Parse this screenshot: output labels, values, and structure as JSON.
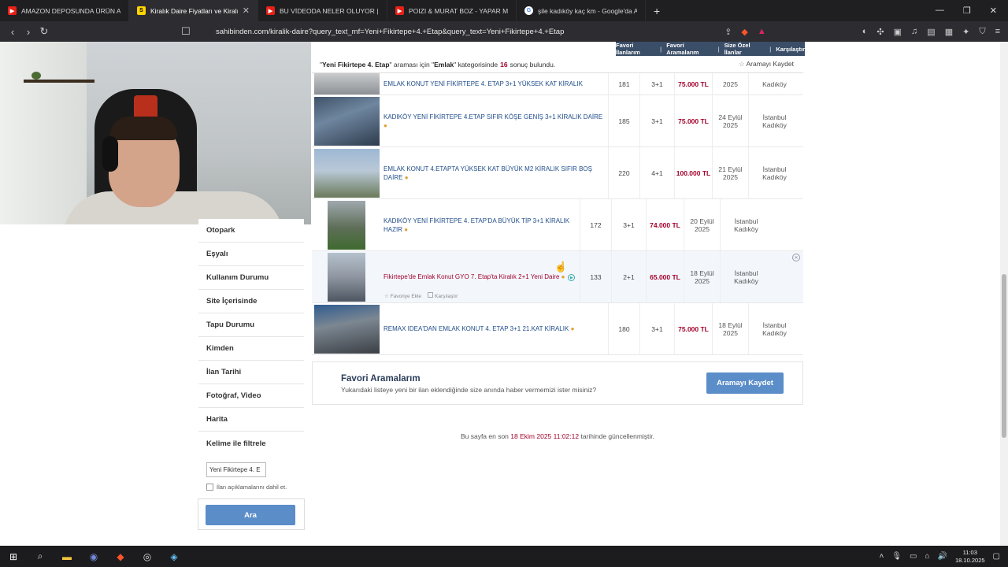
{
  "browser": {
    "tabs": [
      {
        "title": "AMAZON DEPOSUNDA ÜRÜN AYIKLA",
        "fav_color": "#e62117",
        "active": false
      },
      {
        "title": "Kiralık Daire Fiyatları ve Kiralık Ev",
        "fav_color": "#ffd400",
        "fav_text": "S",
        "active": true
      },
      {
        "title": "BU VİDEODA NELER OLUYOR | SHITP",
        "fav_color": "#e62117",
        "active": false
      },
      {
        "title": "POIZI & MURAT BOZ - YAPAR MI",
        "fav_color": "#e62117",
        "active": false
      },
      {
        "title": "şile kadıköy kaç km - Google'da Ara",
        "fav_color": "#4285f4",
        "active": false
      }
    ],
    "url": "sahibinden.com/kiralik-daire?query_text_mf=Yeni+Fikirtepe+4.+Etap&query_text=Yeni+Fikirtepe+4.+Etap"
  },
  "topnav": {
    "fav_listings": "Favori İlanlarım",
    "fav_searches": "Favori Aramalarım",
    "custom_listings": "Size Özel İlanlar",
    "compare": "Karşılaştır"
  },
  "result_summary": {
    "query_quote_open": "\"",
    "query": "Yeni Fikirtepe 4. Etap",
    "middle": "\" araması için \"",
    "category": "Emlak",
    "middle2": "\" kategorisinde",
    "count": "16",
    "suffix": "sonuç bulundu.",
    "save_search": "Aramayı Kaydet"
  },
  "sidebar": {
    "items": [
      "Otopark",
      "Eşyalı",
      "Kullanım Durumu",
      "Site İçerisinde",
      "Tapu Durumu",
      "Kimden",
      "İlan Tarihi",
      "Fotoğraf, Video",
      "Harita",
      "Kelime ile filtrele"
    ],
    "keyword_value": "Yeni Fikirtepe 4. E",
    "include_desc": "İlan açıklamalarını dahil et.",
    "search_button": "Ara"
  },
  "listings": [
    {
      "title": "EMLAK KONUT YENİ FİKİRTEPE 4. ETAP 3+1 YÜKSEK KAT KİRALIK",
      "m2": "181",
      "rooms": "3+1",
      "price": "75.000 TL",
      "date_day": "",
      "date_year": "2025",
      "city": "",
      "district": "Kadıköy",
      "thumb": "#8a8f94"
    },
    {
      "title": "KADIKÖY YENİ FİKİRTEPE 4.ETAP SIFIR KÖŞE GENİŞ 3+1 KİRALIK DAİRE",
      "m2": "185",
      "rooms": "3+1",
      "price": "75.000 TL",
      "date_day": "24 Eylül",
      "date_year": "2025",
      "city": "İstanbul",
      "district": "Kadıköy",
      "thumb": "#4a5d72"
    },
    {
      "title": "EMLAK KONUT 4.ETAPTA YÜKSEK KAT BÜYÜK M2 KİRALIK SIFIR BOŞ DAİRE",
      "m2": "220",
      "rooms": "4+1",
      "price": "100.000 TL",
      "date_day": "21 Eylül",
      "date_year": "2025",
      "city": "İstanbul",
      "district": "Kadıköy",
      "thumb": "#7f9ab3"
    },
    {
      "title": "KADIKÖY YENİ FİKİRTEPE 4. ETAP'DA BÜYÜK TİP 3+1 KİRALIK HAZIR",
      "m2": "172",
      "rooms": "3+1",
      "price": "74.000 TL",
      "date_day": "20 Eylül",
      "date_year": "2025",
      "city": "İstanbul",
      "district": "Kadıköy",
      "thumb": "#5d7a4a"
    },
    {
      "title": "Fikirtepe'de Emlak Konut GYO 7. Etap'ta Kiralık 2+1 Yeni Daire",
      "m2": "133",
      "rooms": "2+1",
      "price": "65.000 TL",
      "date_day": "18 Eylül",
      "date_year": "2025",
      "city": "İstanbul",
      "district": "Kadıköy",
      "thumb": "#8e95a0",
      "fav_label": "Favoriye Ekle",
      "compare_label": "Karşılaştır"
    },
    {
      "title": "REMAX IDEA'DAN EMLAK KONUT 4. ETAP 3+1 21.KAT KİRALIK",
      "m2": "180",
      "rooms": "3+1",
      "price": "75.000 TL",
      "date_day": "18 Eylül",
      "date_year": "2025",
      "city": "İstanbul",
      "district": "Kadıköy",
      "thumb": "#6b7480"
    }
  ],
  "favori": {
    "title": "Favori Aramalarım",
    "subtitle": "Yukarıdaki listeye yeni bir ilan eklendiğinde size anında haber vermemizi ister misiniz?",
    "button": "Aramayı Kaydet"
  },
  "updated": {
    "prefix": "Bu sayfa en son",
    "timestamp": "18 Ekim 2025 11:02:12",
    "suffix": "tarihinde güncellenmiştir."
  },
  "taskbar": {
    "time": "11:03",
    "date": "18.10.2025"
  }
}
